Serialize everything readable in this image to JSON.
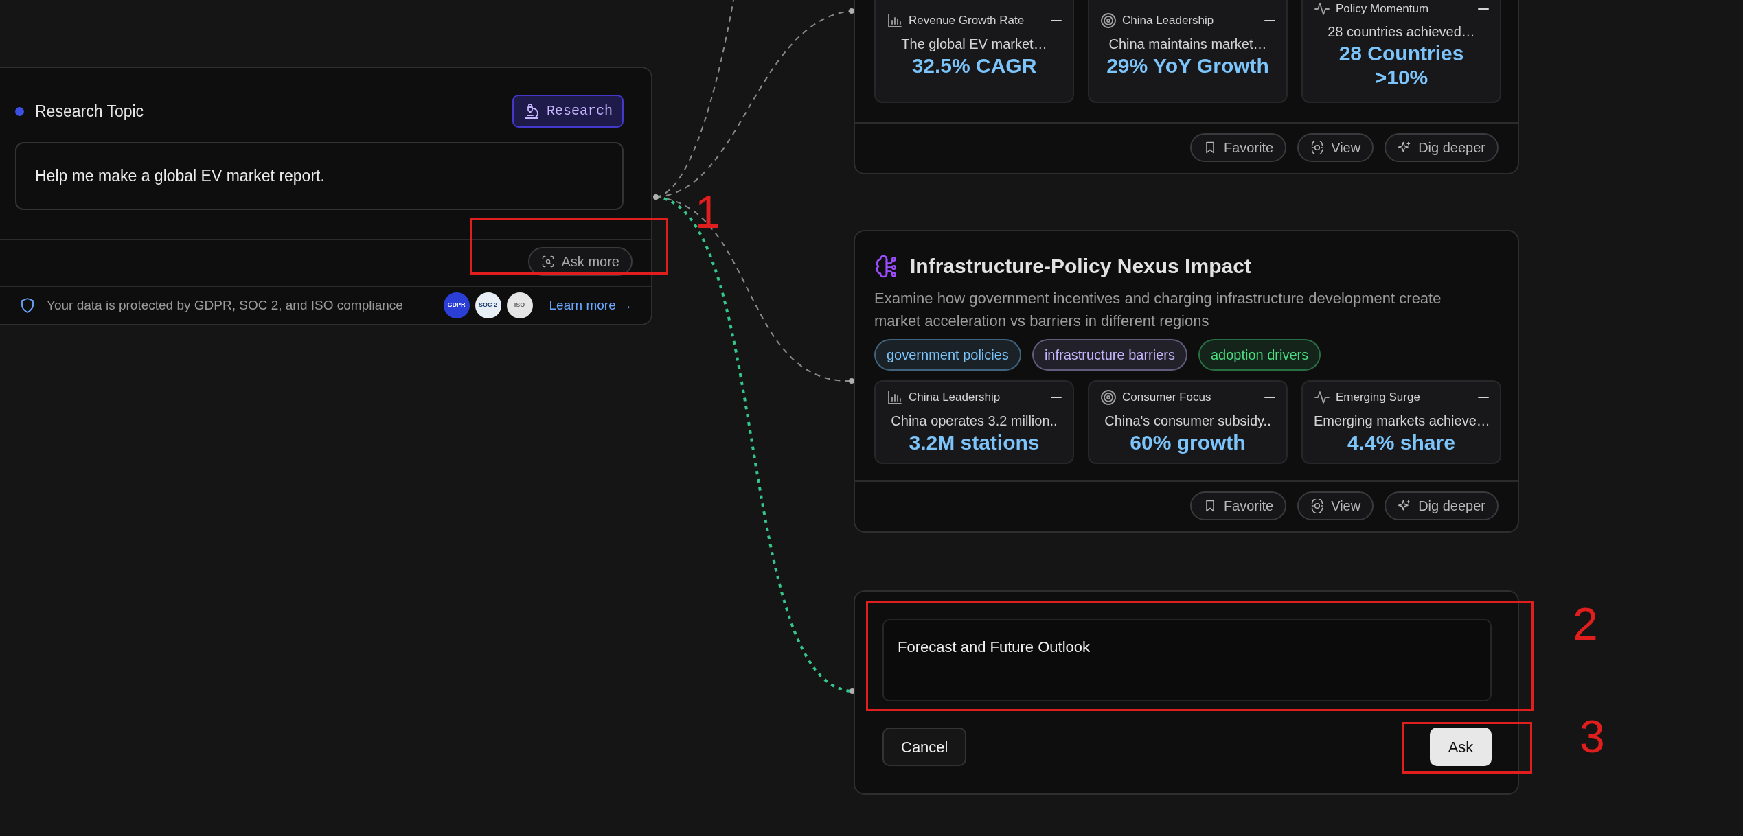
{
  "research_card": {
    "title": "Research Topic",
    "badge": "Research",
    "prompt": "Help me make a global EV market report.",
    "ask_more": "Ask more",
    "compliance": "Your data is protected by GDPR, SOC 2, and ISO compliance",
    "certifications": [
      "GDPR",
      "SOC 2",
      "ISO"
    ],
    "learn_more": "Learn more →"
  },
  "insight_cards": [
    {
      "metrics": [
        {
          "kind": "bars",
          "title": "Revenue Growth Rate",
          "summary": "The global EV market…",
          "value": "32.5% CAGR"
        },
        {
          "kind": "target",
          "title": "China Leadership",
          "summary": "China maintains market…",
          "value": "29% YoY Growth"
        },
        {
          "kind": "pulse",
          "title": "Policy Momentum",
          "summary": "28 countries achieved…",
          "value": "28 Countries >10%"
        }
      ],
      "actions": [
        "Favorite",
        "View",
        "Dig deeper"
      ]
    },
    {
      "title": "Infrastructure-Policy Nexus Impact",
      "description": "Examine how government incentives and charging infrastructure development create market acceleration vs barriers in different regions",
      "tags": [
        {
          "label": "government policies",
          "color": "#7cc4fa"
        },
        {
          "label": "infrastructure barriers",
          "color": "#c4b5fd"
        },
        {
          "label": "adoption drivers",
          "color": "#4ade80"
        }
      ],
      "metrics": [
        {
          "kind": "bars",
          "title": "China Leadership",
          "summary": "China operates 3.2 million..",
          "value": "3.2M stations"
        },
        {
          "kind": "target",
          "title": "Consumer Focus",
          "summary": "China's consumer subsidy..",
          "value": "60% growth"
        },
        {
          "kind": "pulse",
          "title": "Emerging Surge",
          "summary": "Emerging markets achieve…",
          "value": "4.4% share"
        }
      ],
      "actions": [
        "Favorite",
        "View",
        "Dig deeper"
      ]
    }
  ],
  "followup": {
    "value": "Forecast and Future Outlook",
    "cancel": "Cancel",
    "ask": "Ask"
  },
  "connectors": [
    {
      "highlighted": false
    },
    {
      "highlighted": false
    },
    {
      "highlighted": false
    },
    {
      "highlighted": true
    }
  ],
  "annotations": [
    {
      "label": "1"
    },
    {
      "label": "2"
    },
    {
      "label": "3"
    }
  ]
}
